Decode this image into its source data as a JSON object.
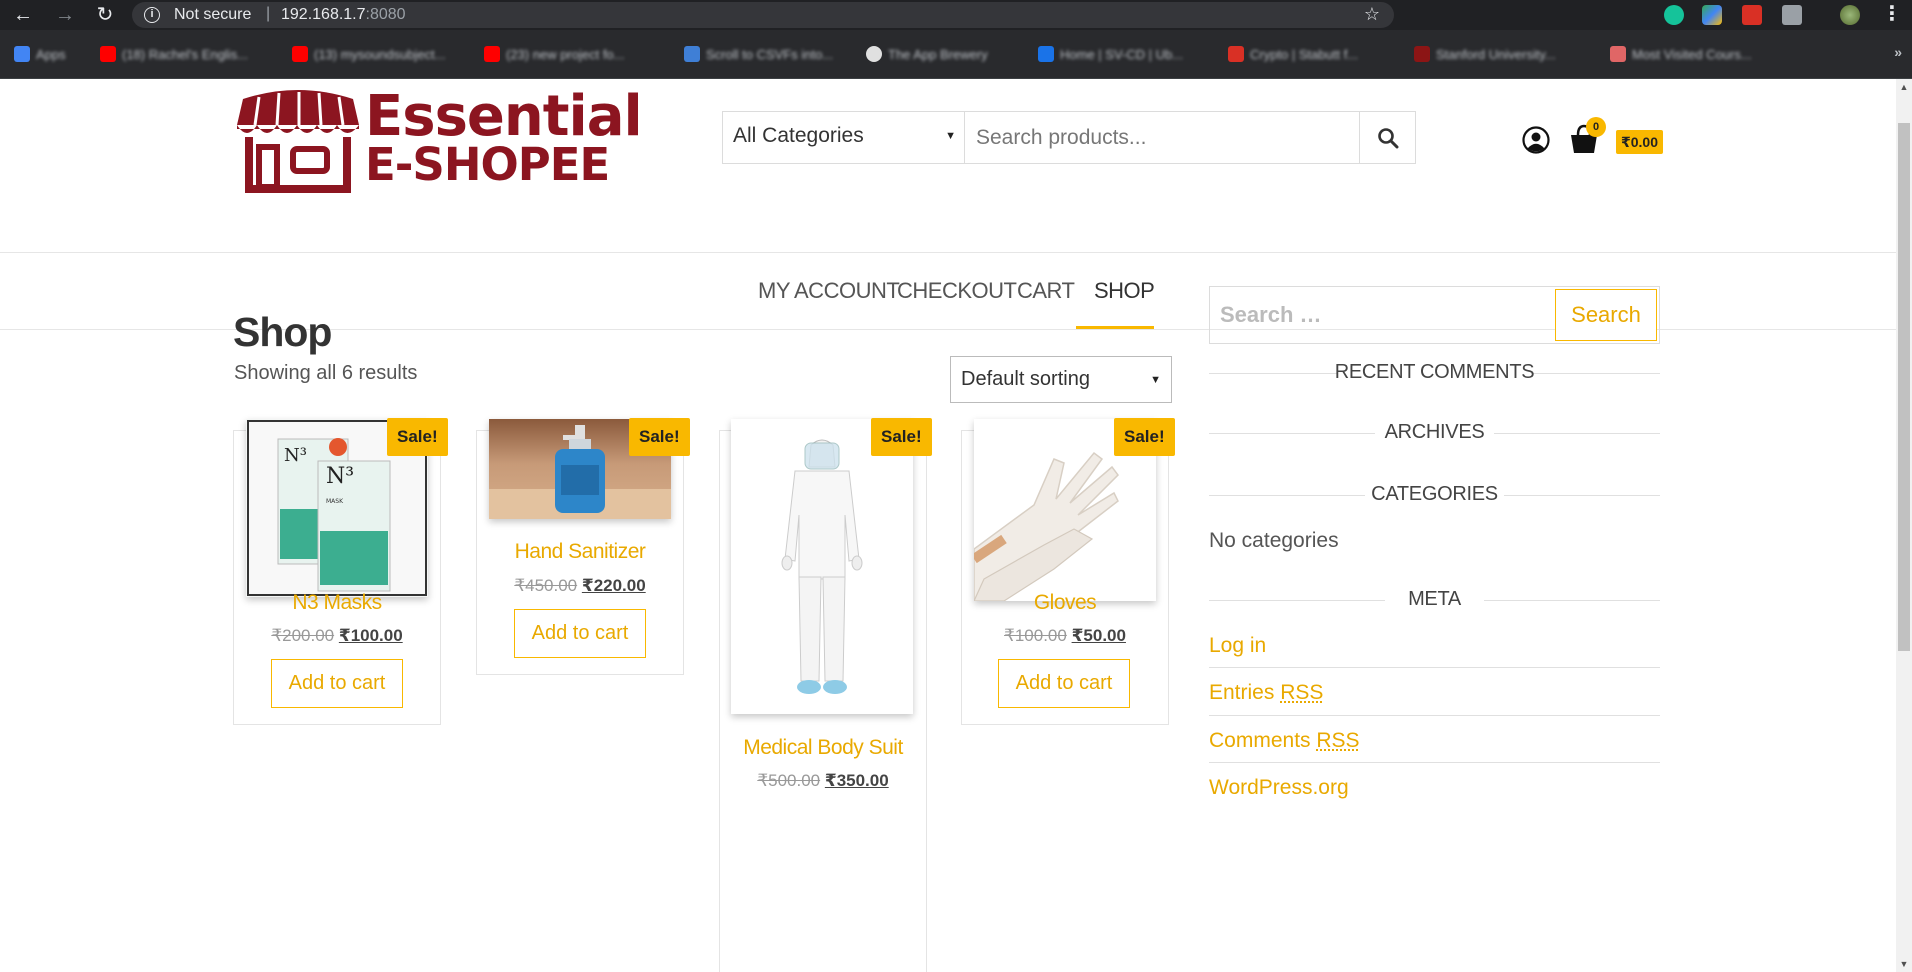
{
  "browser": {
    "security_text": "Not secure",
    "separator": "|",
    "host": "192.168.1.7",
    "port": ":8080",
    "bookmarks": [
      {
        "label": "Apps",
        "color": "#4285f4"
      },
      {
        "label": "(18) Rachel's Englis...",
        "color": "#ff0000"
      },
      {
        "label": "(13) mysoundsubject...",
        "color": "#ff0000"
      },
      {
        "label": "(23) new project fo...",
        "color": "#ff0000"
      },
      {
        "label": "Scroll to CSVFs into...",
        "color": "#3f7fd6"
      },
      {
        "label": "The App Brewery",
        "color": "#e0e0e0"
      },
      {
        "label": "Home | SV-CD | Ub...",
        "color": "#1a73e8"
      },
      {
        "label": "Crypto | Stabutt f...",
        "color": "#d93025"
      },
      {
        "label": "Stanford University...",
        "color": "#8c1515"
      },
      {
        "label": "Most Visited Cours...",
        "color": "#e06666"
      }
    ]
  },
  "site": {
    "logo_line1": "Essential",
    "logo_line2": "E-SHOPEE",
    "brand_color": "#8c1520",
    "accent_color": "#f9b800"
  },
  "header": {
    "category_select": "All Categories",
    "search_placeholder": "Search products...",
    "cart_count": "0",
    "cart_total": "₹0.00"
  },
  "nav": {
    "items": [
      "MY ACCOUNT",
      "CHECKOUT",
      "CART",
      "SHOP"
    ],
    "active": "SHOP"
  },
  "main": {
    "title": "Shop",
    "results_text": "Showing all 6 results",
    "sort_label": "Default sorting",
    "products": [
      {
        "name": "N3 Masks",
        "old_price": "₹200.00",
        "price": "₹100.00",
        "badge": "Sale!",
        "button": "Add to cart"
      },
      {
        "name": "Hand Sanitizer",
        "old_price": "₹450.00",
        "price": "₹220.00",
        "badge": "Sale!",
        "button": "Add to cart"
      },
      {
        "name": "Medical Body Suit",
        "old_price": "₹500.00",
        "price": "₹350.00",
        "badge": "Sale!",
        "button": "Add to cart"
      },
      {
        "name": "Gloves",
        "old_price": "₹100.00",
        "price": "₹50.00",
        "badge": "Sale!",
        "button": "Add to cart"
      }
    ]
  },
  "sidebar": {
    "search_placeholder": "Search …",
    "search_button": "Search",
    "recent_comments": "RECENT COMMENTS",
    "archives": "ARCHIVES",
    "categories": "CATEGORIES",
    "no_categories": "No categories",
    "meta": "META",
    "meta_links": {
      "login": "Log in",
      "entries": "Entries",
      "comments": "Comments",
      "rss": "RSS",
      "wordpress": "WordPress.org"
    }
  }
}
